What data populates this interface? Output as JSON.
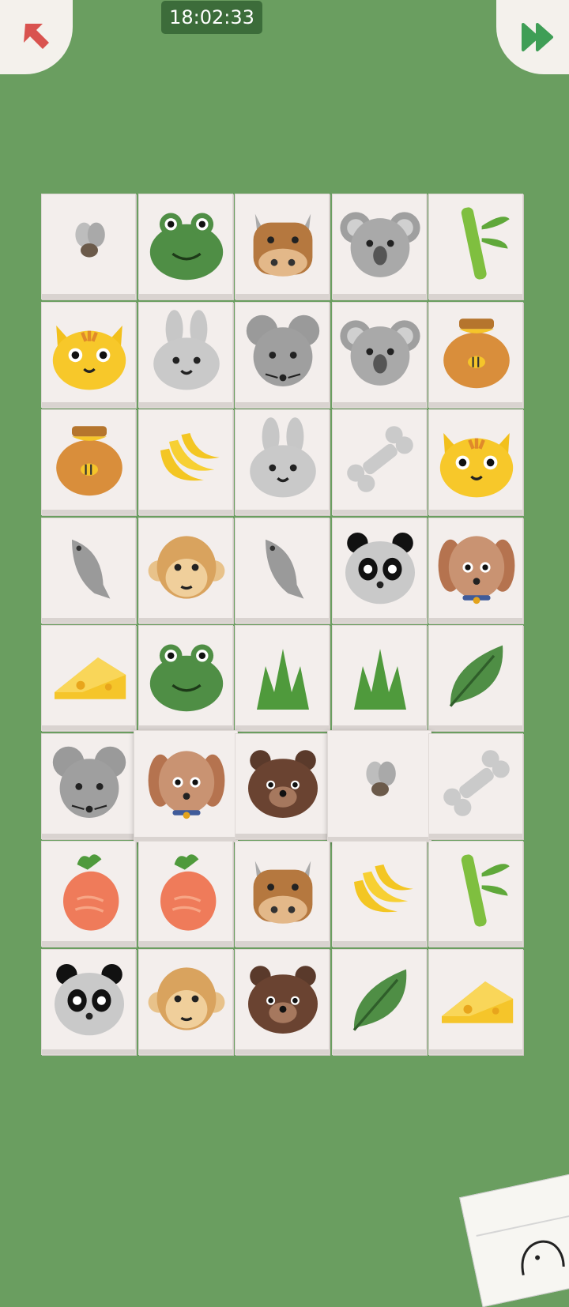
{
  "hud": {
    "time": "18:02:33",
    "back_icon": "arrow-up-left-icon",
    "skip_icon": "fast-forward-icon"
  },
  "board": {
    "columns": 5,
    "rows": 8,
    "grid": [
      [
        "fly",
        "frog",
        "cow",
        "koala",
        "bamboo"
      ],
      [
        "cat",
        "rabbit",
        "mouse",
        "koala",
        "honey-pot"
      ],
      [
        "honey-pot",
        "banana",
        "rabbit",
        "bone",
        "cat"
      ],
      [
        "fish",
        "monkey",
        "fish",
        "panda",
        "dog"
      ],
      [
        "cheese",
        "frog",
        "grass",
        "grass",
        "leaf"
      ],
      [
        "mouse",
        "dog",
        "bear",
        "fly",
        "bone"
      ],
      [
        "carrot",
        "carrot",
        "cow",
        "banana",
        "bamboo"
      ],
      [
        "panda",
        "monkey",
        "bear",
        "leaf",
        "cheese"
      ]
    ],
    "raised_tiles": [
      [
        5,
        1
      ],
      [
        5,
        3
      ]
    ]
  },
  "colors": {
    "background": "#6a9e60",
    "tile": "#f3eeec",
    "clock_bg": "#3c6c3a",
    "back_arrow": "#d9534f",
    "skip_arrow": "#3f9e56"
  }
}
